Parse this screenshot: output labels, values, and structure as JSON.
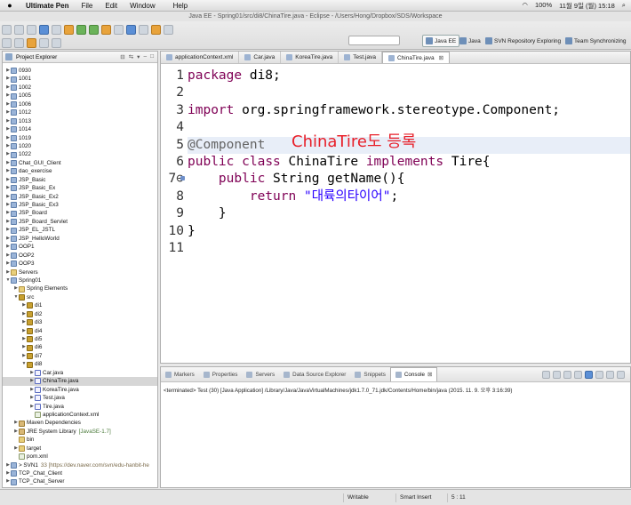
{
  "menubar": {
    "app_name": "Ultimate Pen",
    "items": [
      "File",
      "Edit",
      "Window",
      "Help"
    ],
    "battery": "100%",
    "date_time": "11월 9일 (월)  15:18"
  },
  "window_title": "Java EE - Spring01/src/di8/ChinaTire.java - Eclipse - /Users/Hong/Dropbox/SDS/Workspace",
  "perspectives": [
    "Java EE",
    "Java",
    "SVN Repository Exploring",
    "Team Synchronizing"
  ],
  "explorer": {
    "title": "Project Explorer",
    "nodes": [
      {
        "label": "0930",
        "depth": 0,
        "icon": "proj"
      },
      {
        "label": "1001",
        "depth": 0,
        "icon": "proj"
      },
      {
        "label": "1002",
        "depth": 0,
        "icon": "proj"
      },
      {
        "label": "1005",
        "depth": 0,
        "icon": "proj"
      },
      {
        "label": "1006",
        "depth": 0,
        "icon": "proj"
      },
      {
        "label": "1012",
        "depth": 0,
        "icon": "proj"
      },
      {
        "label": "1013",
        "depth": 0,
        "icon": "proj"
      },
      {
        "label": "1014",
        "depth": 0,
        "icon": "proj"
      },
      {
        "label": "1019",
        "depth": 0,
        "icon": "proj"
      },
      {
        "label": "1020",
        "depth": 0,
        "icon": "proj"
      },
      {
        "label": "1022",
        "depth": 0,
        "icon": "proj"
      },
      {
        "label": "Chat_GUI_Client",
        "depth": 0,
        "icon": "proj"
      },
      {
        "label": "dao_exercise",
        "depth": 0,
        "icon": "proj"
      },
      {
        "label": "JSP_Basic",
        "depth": 0,
        "icon": "proj"
      },
      {
        "label": "JSP_Basic_Ex",
        "depth": 0,
        "icon": "proj"
      },
      {
        "label": "JSP_Basic_Ex2",
        "depth": 0,
        "icon": "proj"
      },
      {
        "label": "JSP_Basic_Ex3",
        "depth": 0,
        "icon": "proj"
      },
      {
        "label": "JSP_Board",
        "depth": 0,
        "icon": "proj"
      },
      {
        "label": "JSP_Board_Servlet",
        "depth": 0,
        "icon": "proj"
      },
      {
        "label": "JSP_EL_JSTL",
        "depth": 0,
        "icon": "proj"
      },
      {
        "label": "JSP_HelloWorld",
        "depth": 0,
        "icon": "proj"
      },
      {
        "label": "OOP1",
        "depth": 0,
        "icon": "proj"
      },
      {
        "label": "OOP2",
        "depth": 0,
        "icon": "proj"
      },
      {
        "label": "OOP3",
        "depth": 0,
        "icon": "proj"
      },
      {
        "label": "Servers",
        "depth": 0,
        "icon": "folder"
      },
      {
        "label": "Spring01",
        "depth": 0,
        "icon": "proj",
        "open": true
      },
      {
        "label": "Spring Elements",
        "depth": 1,
        "icon": "folder"
      },
      {
        "label": "src",
        "depth": 1,
        "icon": "pkg",
        "open": true
      },
      {
        "label": "di1",
        "depth": 2,
        "icon": "pkg"
      },
      {
        "label": "di2",
        "depth": 2,
        "icon": "pkg"
      },
      {
        "label": "di3",
        "depth": 2,
        "icon": "pkg"
      },
      {
        "label": "di4",
        "depth": 2,
        "icon": "pkg"
      },
      {
        "label": "di5",
        "depth": 2,
        "icon": "pkg"
      },
      {
        "label": "di6",
        "depth": 2,
        "icon": "pkg"
      },
      {
        "label": "di7",
        "depth": 2,
        "icon": "pkg"
      },
      {
        "label": "di8",
        "depth": 2,
        "icon": "pkg",
        "open": true
      },
      {
        "label": "Car.java",
        "depth": 3,
        "icon": "java"
      },
      {
        "label": "ChinaTire.java",
        "depth": 3,
        "icon": "java",
        "selected": true
      },
      {
        "label": "KoreaTire.java",
        "depth": 3,
        "icon": "java"
      },
      {
        "label": "Test.java",
        "depth": 3,
        "icon": "java"
      },
      {
        "label": "Tire.java",
        "depth": 3,
        "icon": "java"
      },
      {
        "label": "applicationContext.xml",
        "depth": 3,
        "icon": "xml",
        "leaf": true
      },
      {
        "label": "Maven Dependencies",
        "depth": 1,
        "icon": "lib"
      },
      {
        "label": "JRE System Library",
        "extra": "[JavaSE-1.7]",
        "depth": 1,
        "icon": "lib"
      },
      {
        "label": "bin",
        "depth": 1,
        "icon": "folder",
        "leaf": true
      },
      {
        "label": "target",
        "depth": 1,
        "icon": "folder"
      },
      {
        "label": "pom.xml",
        "depth": 1,
        "icon": "xml",
        "leaf": true
      },
      {
        "label": "> SVN1",
        "extra": "33 [https://dev.naver.com/svn/edu-hanbit-he",
        "depth": 0,
        "icon": "proj",
        "svn": true
      },
      {
        "label": "TCP_Chat_Client",
        "depth": 0,
        "icon": "proj"
      },
      {
        "label": "TCP_Chat_Server",
        "depth": 0,
        "icon": "proj"
      }
    ]
  },
  "editor": {
    "tabs": [
      {
        "label": "applicationContext.xml",
        "active": false
      },
      {
        "label": "Car.java",
        "active": false
      },
      {
        "label": "KoreaTire.java",
        "active": false
      },
      {
        "label": "Test.java",
        "active": false
      },
      {
        "label": "ChinaTire.java",
        "active": true
      }
    ],
    "lines": [
      {
        "num": "1",
        "tokens": [
          {
            "t": "package",
            "c": "kw"
          },
          {
            "t": " di8;",
            "c": ""
          }
        ]
      },
      {
        "num": "2",
        "tokens": []
      },
      {
        "num": "3",
        "tokens": [
          {
            "t": "import",
            "c": "kw"
          },
          {
            "t": " org.springframework.stereotype.Component;",
            "c": ""
          }
        ]
      },
      {
        "num": "4",
        "tokens": []
      },
      {
        "num": "5",
        "tokens": [
          {
            "t": "@Component",
            "c": "ann"
          }
        ],
        "highlight": true
      },
      {
        "num": "6",
        "tokens": [
          {
            "t": "public",
            "c": "kw"
          },
          {
            "t": " ",
            "c": ""
          },
          {
            "t": "class",
            "c": "kw"
          },
          {
            "t": " ChinaTire ",
            "c": ""
          },
          {
            "t": "implements",
            "c": "kw"
          },
          {
            "t": " Tire{",
            "c": ""
          }
        ]
      },
      {
        "num": "7⊖",
        "tokens": [
          {
            "t": "    ",
            "c": ""
          },
          {
            "t": "public",
            "c": "kw"
          },
          {
            "t": " String getName(){",
            "c": ""
          }
        ],
        "marker": true
      },
      {
        "num": "8",
        "tokens": [
          {
            "t": "        ",
            "c": ""
          },
          {
            "t": "return",
            "c": "kw"
          },
          {
            "t": " ",
            "c": ""
          },
          {
            "t": "\"대륙의타이어\"",
            "c": "str"
          },
          {
            "t": ";",
            "c": ""
          }
        ]
      },
      {
        "num": "9",
        "tokens": [
          {
            "t": "    }",
            "c": ""
          }
        ]
      },
      {
        "num": "10",
        "tokens": [
          {
            "t": "}",
            "c": ""
          }
        ]
      },
      {
        "num": "11",
        "tokens": []
      }
    ],
    "overlay_note": "ChinaTire도 등록"
  },
  "console": {
    "tabs": [
      {
        "label": "Markers",
        "active": false
      },
      {
        "label": "Properties",
        "active": false
      },
      {
        "label": "Servers",
        "active": false
      },
      {
        "label": "Data Source Explorer",
        "active": false
      },
      {
        "label": "Snippets",
        "active": false
      },
      {
        "label": "Console",
        "active": true
      }
    ],
    "terminated_line": "<terminated> Test (30) [Java Application] /Library/Java/JavaVirtualMachines/jdk1.7.0_71.jdk/Contents/Home/bin/java (2015. 11. 9. 오후 3:16:39)"
  },
  "statusbar": {
    "mode": "Writable",
    "insert": "Smart Insert",
    "position": "5 : 11"
  }
}
